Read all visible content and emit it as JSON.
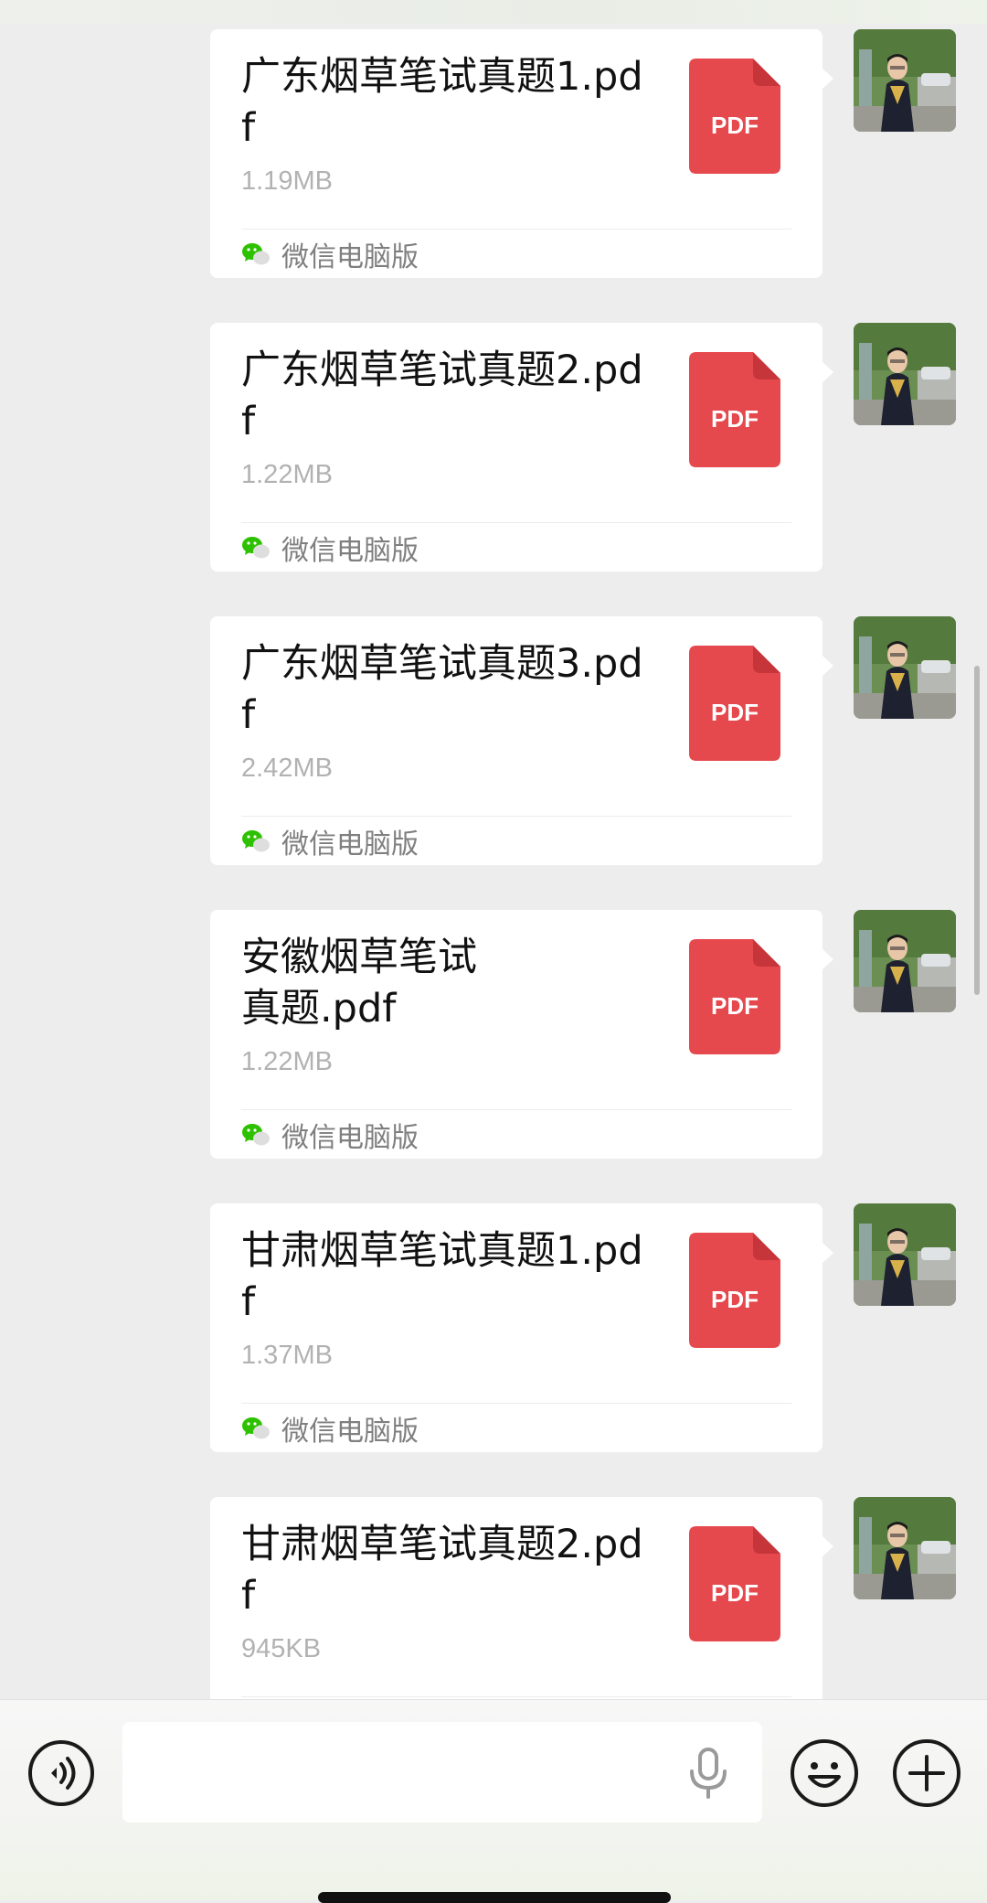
{
  "messages": [
    {
      "file_name": "广东烟草笔试真题1.pdf",
      "file_size": "1.19MB",
      "file_type_label": "PDF",
      "source_label": "微信电脑版"
    },
    {
      "file_name": "广东烟草笔试真题2.pdf",
      "file_size": "1.22MB",
      "file_type_label": "PDF",
      "source_label": "微信电脑版"
    },
    {
      "file_name": "广东烟草笔试真题3.pdf",
      "file_size": "2.42MB",
      "file_type_label": "PDF",
      "source_label": "微信电脑版"
    },
    {
      "file_name": "安徽烟草笔试真题.pdf",
      "file_size": "1.22MB",
      "file_type_label": "PDF",
      "source_label": "微信电脑版"
    },
    {
      "file_name": "甘肃烟草笔试真题1.pdf",
      "file_size": "1.37MB",
      "file_type_label": "PDF",
      "source_label": "微信电脑版"
    },
    {
      "file_name": "甘肃烟草笔试真题2.pdf",
      "file_size": "945KB",
      "file_type_label": "PDF",
      "source_label": ""
    }
  ],
  "input_bar": {
    "text_value": "",
    "icons": {
      "voice": "voice-mode-icon",
      "mic": "microphone-icon",
      "emoji": "emoji-icon",
      "plus": "plus-icon"
    }
  },
  "colors": {
    "chat_background": "#ededed",
    "bubble": "#ffffff",
    "pdf_red": "#e5484d",
    "pdf_fold": "#c5353a",
    "file_size_text": "#b2b2b2",
    "source_text": "#7f7f7f",
    "wechat_green": "#2dc100"
  }
}
